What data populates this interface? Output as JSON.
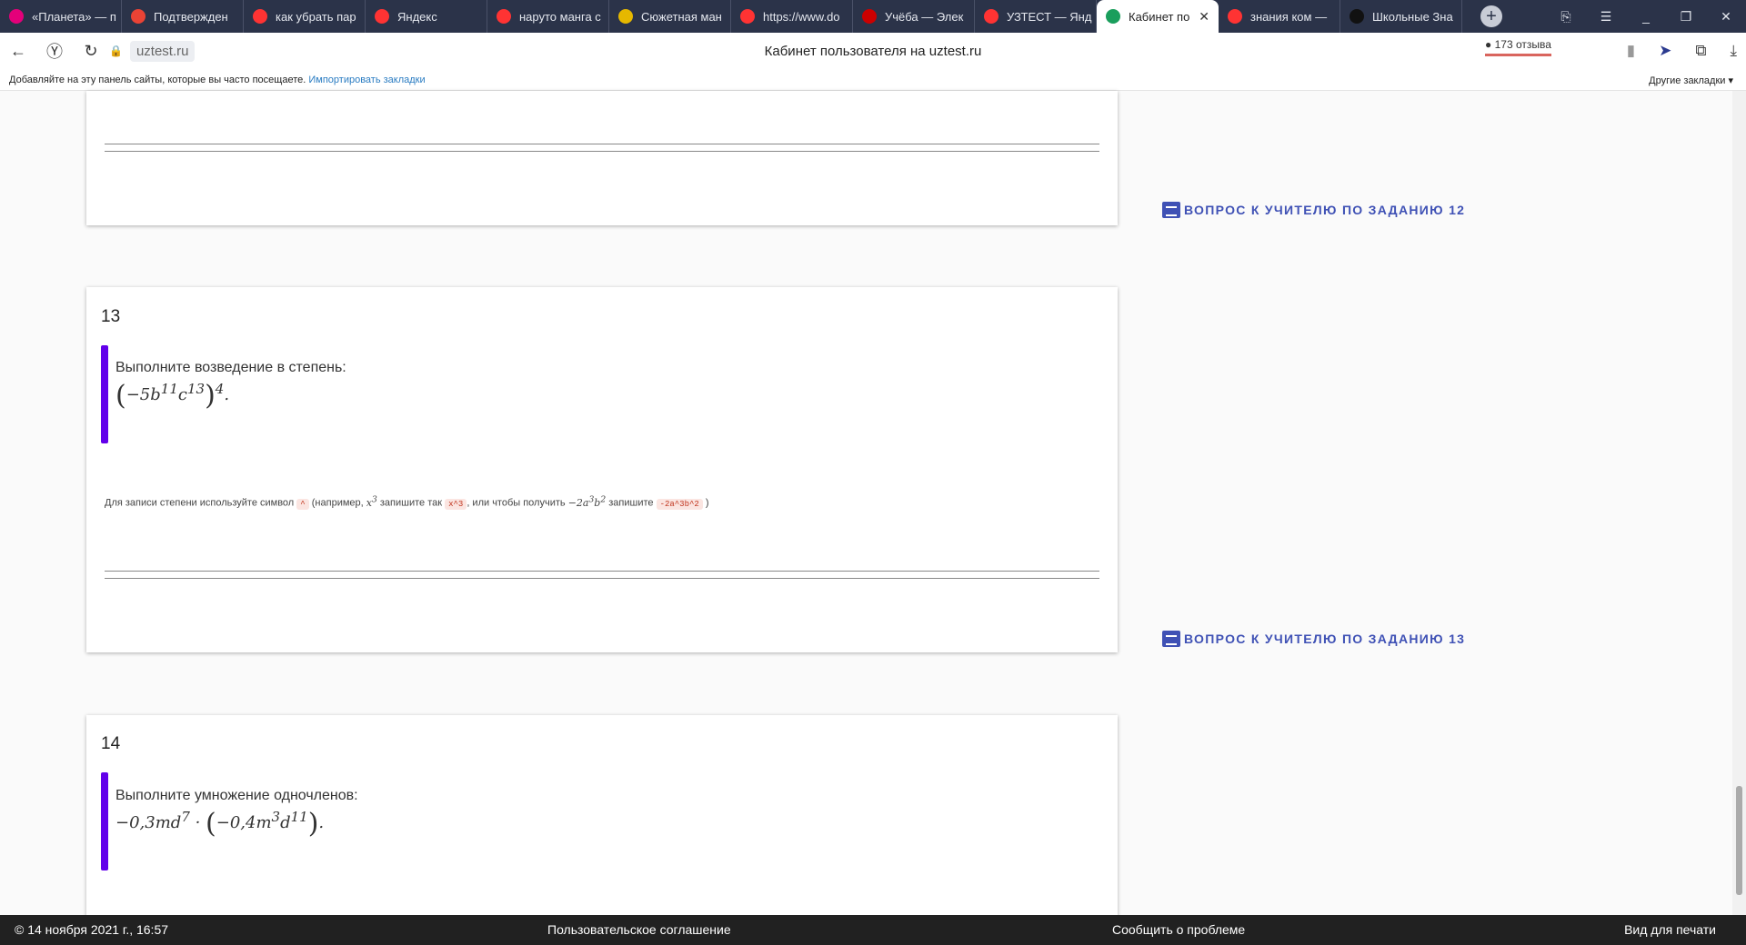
{
  "browser": {
    "tabs": [
      {
        "label": "«Планета» — п",
        "color": "#e4007a"
      },
      {
        "label": "Подтвержден",
        "color": "#ea4335"
      },
      {
        "label": "как убрать пар",
        "color": "#f33"
      },
      {
        "label": "Яндекс",
        "color": "#f33"
      },
      {
        "label": "наруто манга с",
        "color": "#f33"
      },
      {
        "label": "Сюжетная ман",
        "color": "#e6b800"
      },
      {
        "label": "https://www.do",
        "color": "#f33"
      },
      {
        "label": "Учёба — Элек",
        "color": "#c00"
      },
      {
        "label": "УЗТЕСТ — Янд",
        "color": "#f33"
      },
      {
        "label": "Кабинет по",
        "color": "#1a9e5c"
      },
      {
        "label": "знания ком —",
        "color": "#f33"
      },
      {
        "label": "Школьные Зна",
        "color": "#111"
      }
    ],
    "active_tab_close": "✕",
    "url": "uztest.ru",
    "page_title": "Кабинет пользователя на uztest.ru",
    "reviews": "173 отзыва",
    "bookmarks_hint": "Добавляйте на эту панель сайты, которые вы часто посещаете.",
    "import_link": "Импортировать закладки",
    "other_bookmarks": "Другие закладки ▾"
  },
  "tasks": [
    {
      "number": "13",
      "question": "Выполните возведение в степень:",
      "ask": "ВОПРОС К УЧИТЕЛЮ ПО ЗАДАНИЮ 13"
    },
    {
      "number": "14",
      "question": "Выполните умножение одночленов:"
    }
  ],
  "ask_prev": "ВОПРОС К УЧИТЕЛЮ ПО ЗАДАНИЮ 12",
  "hint": {
    "t1": "Для записи степени используйте символ",
    "c1": "^",
    "t2": "(например,",
    "t3": "запишите так",
    "c2": "x^3",
    "t4": ", или чтобы получить",
    "t5": "запишите",
    "c3": "-2a^3b^2",
    "t6": ")"
  },
  "footer": {
    "date": "© 14 ноября 2021 г., 16:57",
    "agreement": "Пользовательское соглашение",
    "report": "Сообщить о проблеме",
    "print": "Вид для печати"
  }
}
